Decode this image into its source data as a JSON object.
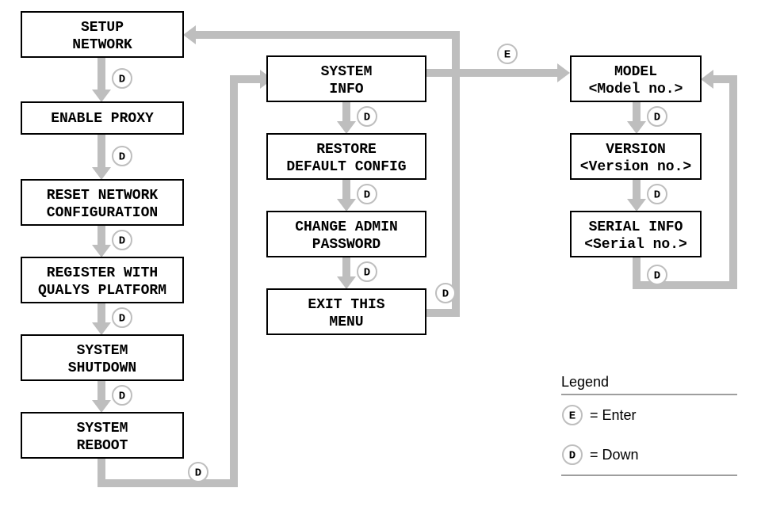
{
  "col1": {
    "n0": {
      "line1": "SETUP",
      "line2": "NETWORK"
    },
    "n1": {
      "line1": "ENABLE PROXY"
    },
    "n2": {
      "line1": "RESET NETWORK",
      "line2": "CONFIGURATION"
    },
    "n3": {
      "line1": "REGISTER WITH",
      "line2": "QUALYS PLATFORM"
    },
    "n4": {
      "line1": "SYSTEM",
      "line2": "SHUTDOWN"
    },
    "n5": {
      "line1": "SYSTEM",
      "line2": "REBOOT"
    }
  },
  "col2": {
    "n0": {
      "line1": "SYSTEM",
      "line2": "INFO"
    },
    "n1": {
      "line1": "RESTORE",
      "line2": "DEFAULT CONFIG"
    },
    "n2": {
      "line1": "CHANGE ADMIN",
      "line2": "PASSWORD"
    },
    "n3": {
      "line1": "EXIT THIS",
      "line2": "MENU"
    }
  },
  "col3": {
    "n0": {
      "line1": "MODEL",
      "line2": "<Model no.>"
    },
    "n1": {
      "line1": "VERSION",
      "line2": "<Version no.>"
    },
    "n2": {
      "line1": "SERIAL INFO",
      "line2": "<Serial no.>"
    }
  },
  "badges": {
    "D": "D",
    "E": "E"
  },
  "legend": {
    "title": "Legend",
    "enter": "= Enter",
    "down": "= Down"
  }
}
